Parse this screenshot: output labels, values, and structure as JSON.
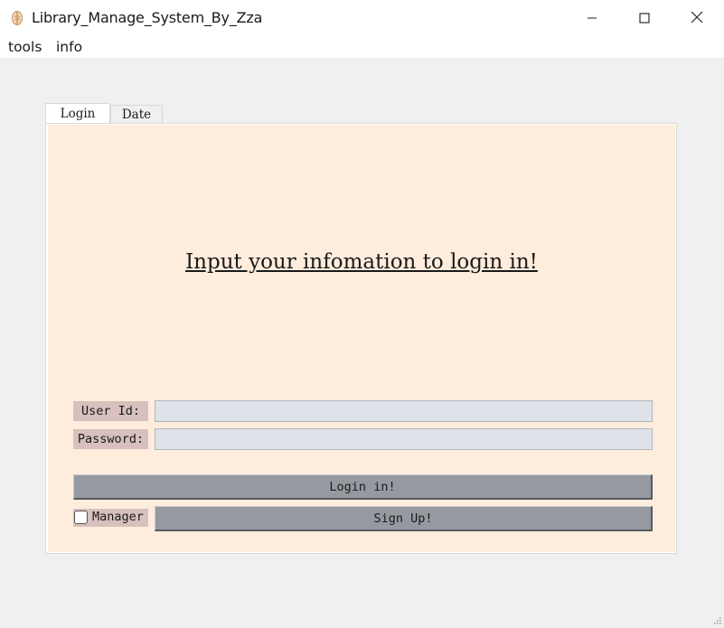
{
  "window": {
    "title": "Library_Manage_System_By_Zza",
    "icon": "leaf-feather-icon",
    "controls": [
      "minimize-icon",
      "maximize-icon",
      "close-icon"
    ]
  },
  "menu": {
    "items": [
      {
        "label": "tools"
      },
      {
        "label": "info"
      }
    ]
  },
  "tabs": [
    {
      "label": "Login",
      "active": true
    },
    {
      "label": "Date",
      "active": false
    }
  ],
  "login": {
    "heading": "Input your infomation to login in!",
    "user_id_label": "User Id:",
    "user_id_value": "",
    "password_label": "Password:",
    "password_value": "",
    "login_button": "Login in!",
    "manager_label": "Manager",
    "manager_checked": false,
    "signup_button": "Sign Up!"
  },
  "colors": {
    "panel_bg": "#feeddd",
    "label_bg": "#d7c0bd",
    "entry_bg": "#dde3e9",
    "button_bg": "#969aa0"
  }
}
